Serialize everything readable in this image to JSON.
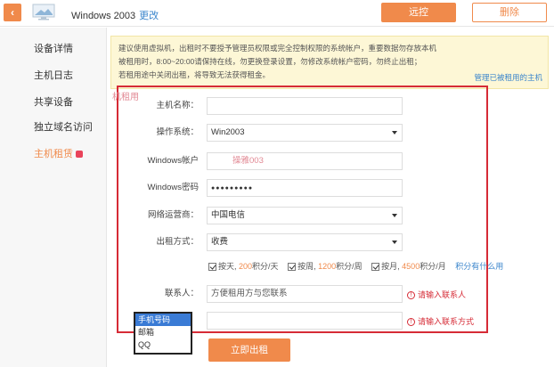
{
  "header": {
    "back_icon": "chevron-left-icon",
    "host_name": "Windows 2003",
    "edit_label": "更改",
    "remote_label": "远控",
    "delete_label": "删除"
  },
  "sidebar": {
    "items": [
      {
        "label": "设备详情"
      },
      {
        "label": "主机日志"
      },
      {
        "label": "共享设备"
      },
      {
        "label": "独立域名访问"
      },
      {
        "label": "主机租赁"
      }
    ]
  },
  "notice": {
    "lines": [
      "建议使用虚拟机，出租时不要授予管理员权限或完全控制权限的系统帐户，重要数据勿存放本机",
      "被租用时，8:00~20:00请保持在线，勿更换登录设置，勿修改系统帐户密码，勿终止出租；",
      "若租用途中关闭出租，将导致无法获得租金。"
    ],
    "manage_link": "管理已被租用的主机"
  },
  "form": {
    "host_label": "主机名称：",
    "host_watermark": "机租用",
    "os_label": "操作系统：",
    "os_value": "Win2003",
    "account_label": "Windows帐户",
    "account_value": "操雅003",
    "password_label": "Windows密码",
    "password_value": "●●●●●●●●●",
    "isp_label": "网络运营商：",
    "isp_value": "中国电信",
    "rent_label": "出租方式：",
    "rent_value": "收费",
    "options": {
      "day_prefix": "按天, ",
      "day_price": "200",
      "day_suffix": "积分/天",
      "week_prefix": "按周, ",
      "week_price": "1200",
      "week_suffix": "积分/周",
      "month_prefix": "按月, ",
      "month_price": "4500",
      "month_suffix": "积分/月",
      "points_link": "积分有什么用"
    },
    "contact_label": "联系人：",
    "contact_value": "方便租用方与您联系",
    "contact_error": "请输入联系人",
    "contact_method_error": "请输入联系方式",
    "contact_method_options": [
      "手机号码",
      "邮箱",
      "QQ"
    ],
    "submit_label": "立即出租"
  }
}
